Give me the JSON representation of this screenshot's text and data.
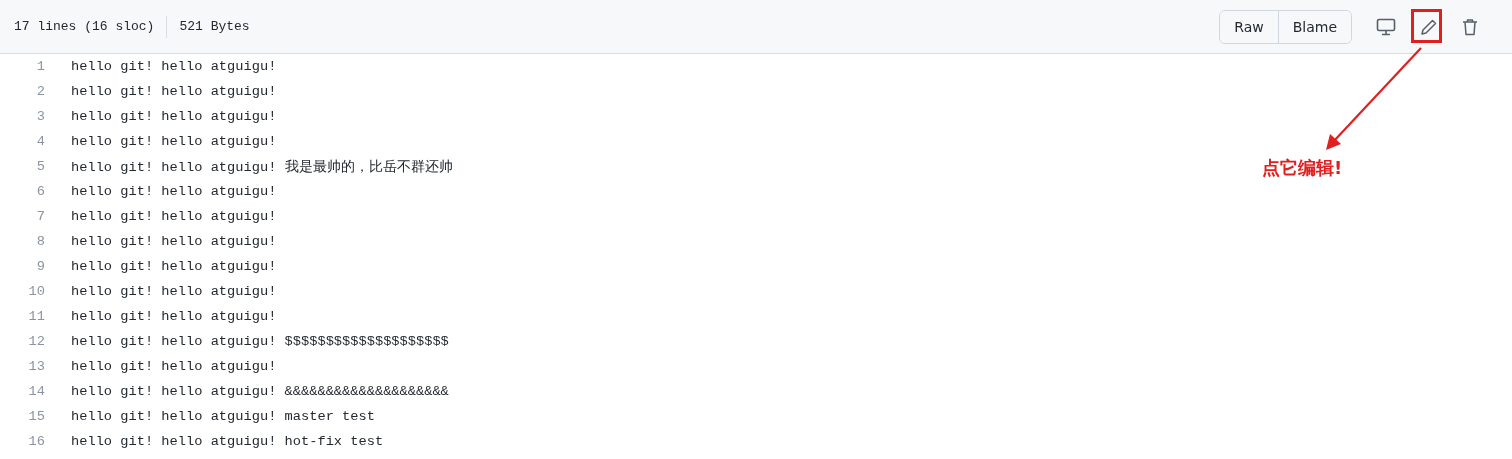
{
  "file_info": {
    "lines": "17 lines (16 sloc)",
    "size": "521 Bytes"
  },
  "buttons": [
    "Raw",
    "Blame"
  ],
  "code_lines": [
    {
      "number": "1",
      "text": "hello git! hello atguigu!"
    },
    {
      "number": "2",
      "text": "hello git! hello atguigu!"
    },
    {
      "number": "3",
      "text": "hello git! hello atguigu!"
    },
    {
      "number": "4",
      "text": "hello git! hello atguigu!"
    },
    {
      "number": "5",
      "text": "hello git! hello atguigu! 我是最帅的，比岳不群还帅"
    },
    {
      "number": "6",
      "text": "hello git! hello atguigu!"
    },
    {
      "number": "7",
      "text": "hello git! hello atguigu!"
    },
    {
      "number": "8",
      "text": "hello git! hello atguigu!"
    },
    {
      "number": "9",
      "text": "hello git! hello atguigu!"
    },
    {
      "number": "10",
      "text": "hello git! hello atguigu!"
    },
    {
      "number": "11",
      "text": "hello git! hello atguigu!"
    },
    {
      "number": "12",
      "text": "hello git! hello atguigu! $$$$$$$$$$$$$$$$$$$$"
    },
    {
      "number": "13",
      "text": "hello git! hello atguigu!"
    },
    {
      "number": "14",
      "text": "hello git! hello atguigu! &&&&&&&&&&&&&&&&&&&&"
    },
    {
      "number": "15",
      "text": "hello git! hello atguigu! master test"
    },
    {
      "number": "16",
      "text": "hello git! hello atguigu! hot-fix test"
    }
  ],
  "annotation": {
    "text": "点它编辑!"
  }
}
